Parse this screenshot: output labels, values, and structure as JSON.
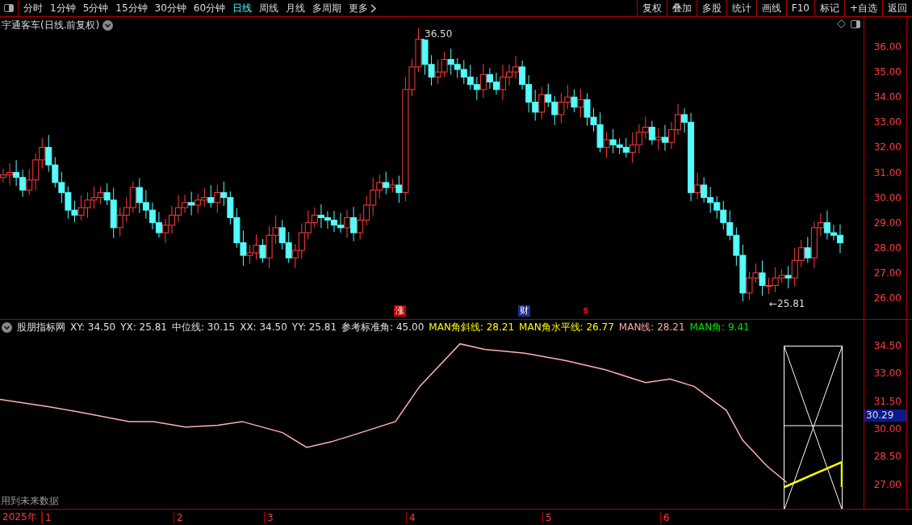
{
  "toolbar": {
    "periods": [
      {
        "label": "分时",
        "selected": false
      },
      {
        "label": "1分钟",
        "selected": false
      },
      {
        "label": "5分钟",
        "selected": false
      },
      {
        "label": "15分钟",
        "selected": false
      },
      {
        "label": "30分钟",
        "selected": false
      },
      {
        "label": "60分钟",
        "selected": false
      },
      {
        "label": "日线",
        "selected": true
      },
      {
        "label": "周线",
        "selected": false
      },
      {
        "label": "月线",
        "selected": false
      },
      {
        "label": "多周期",
        "selected": false
      }
    ],
    "more": "更多",
    "buttons": [
      "复权",
      "叠加",
      "多股",
      "统计",
      "画线",
      "F10",
      "标记",
      "+自选",
      "返回"
    ]
  },
  "main_chart": {
    "title": "宇通客车(日线.前复权)",
    "high_label": "36.50",
    "low_label": "←25.81",
    "price_ticks": [
      "36.00",
      "35.00",
      "34.00",
      "33.00",
      "32.00",
      "31.00",
      "30.00",
      "29.00",
      "28.00",
      "27.00",
      "26.00"
    ],
    "markers": [
      {
        "text": "涨",
        "kind": "badge",
        "color": "#c00000"
      },
      {
        "text": "财",
        "kind": "badge",
        "color": "#1c2f8c"
      },
      {
        "text": "$",
        "kind": "text",
        "color": "#e01010"
      }
    ]
  },
  "indicator": {
    "name": "股朋指标网",
    "values": [
      {
        "text": "XY: 34.50",
        "color": "#e0e0e0"
      },
      {
        "text": "YX: 25.81",
        "color": "#e0e0e0"
      },
      {
        "text": "中位线: 30.15",
        "color": "#e0e0e0"
      },
      {
        "text": "XX: 34.50",
        "color": "#e0e0e0"
      },
      {
        "text": "YY: 25.81",
        "color": "#e0e0e0"
      },
      {
        "text": "参考标准角: 45.00",
        "color": "#e0e0e0"
      },
      {
        "text": "MAN角斜线: 28.21",
        "color": "#ffff00"
      },
      {
        "text": "MAN角水平线: 26.77",
        "color": "#ffff00"
      },
      {
        "text": "MAN线: 28.21",
        "color": "#ffa8a8"
      },
      {
        "text": "MAN角: 9.41",
        "color": "#00e000"
      }
    ],
    "ticks": [
      "34.50",
      "33.00",
      "31.50",
      "30.00",
      "28.50",
      "27.00"
    ],
    "current_value": "30.29",
    "warning": "用到未来数据"
  },
  "time_axis": {
    "year": "2025年",
    "months": [
      "1",
      "2",
      "3",
      "4",
      "5",
      "6"
    ]
  }
}
